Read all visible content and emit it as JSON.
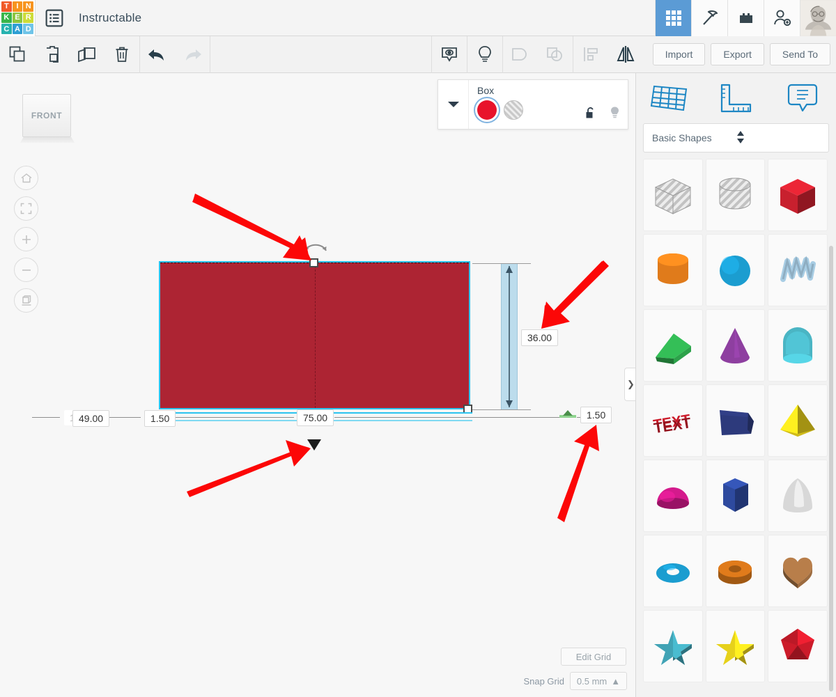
{
  "app": {
    "brand_letters": [
      "T",
      "I",
      "N",
      "K",
      "E",
      "R",
      "C",
      "A",
      "D"
    ],
    "brand_colors": [
      "#f15a29",
      "#f7941e",
      "#f7941e",
      "#39b54a",
      "#8dc63f",
      "#cddc39",
      "#27b3b0",
      "#2e9fd4",
      "#6fc4e8"
    ],
    "document_title": "Instructable"
  },
  "topbar": {
    "icons": [
      {
        "name": "hamburger-menu-icon",
        "label": "Menu"
      },
      {
        "name": "grid-apps-icon",
        "label": "Apps",
        "active": true
      },
      {
        "name": "pickaxe-minecraft-icon",
        "label": "Minecraft"
      },
      {
        "name": "lego-brick-icon",
        "label": "Blocks"
      },
      {
        "name": "add-person-icon",
        "label": "Invite"
      },
      {
        "name": "user-avatar",
        "label": "Account"
      }
    ]
  },
  "toolbar": {
    "left_tools": [
      {
        "name": "copy-icon",
        "label": "Copy"
      },
      {
        "name": "paste-icon",
        "label": "Paste"
      },
      {
        "name": "duplicate-icon",
        "label": "Duplicate"
      },
      {
        "name": "delete-trash-icon",
        "label": "Delete"
      }
    ],
    "history_tools": [
      {
        "name": "undo-icon",
        "label": "Undo",
        "enabled": true
      },
      {
        "name": "redo-icon",
        "label": "Redo",
        "enabled": false
      }
    ],
    "right_tools": [
      {
        "name": "visibility-eye-icon",
        "label": "Show all",
        "enabled": true
      },
      {
        "name": "lightbulb-icon",
        "label": "Hide",
        "enabled": true
      },
      {
        "name": "group-icon",
        "label": "Group",
        "enabled": false
      },
      {
        "name": "ungroup-icon",
        "label": "Ungroup",
        "enabled": false
      },
      {
        "name": "align-icon",
        "label": "Align",
        "enabled": true
      },
      {
        "name": "mirror-flip-icon",
        "label": "Mirror",
        "enabled": true
      }
    ],
    "import_label": "Import",
    "export_label": "Export",
    "sendto_label": "Send To"
  },
  "canvas": {
    "view_cube_label": "FRONT",
    "nav_buttons": [
      {
        "name": "home-view-icon",
        "label": "Home view"
      },
      {
        "name": "fit-to-view-icon",
        "label": "Fit all in view"
      },
      {
        "name": "zoom-in-icon",
        "label": "Zoom in"
      },
      {
        "name": "zoom-out-icon",
        "label": "Zoom out"
      },
      {
        "name": "orthographic-toggle-icon",
        "label": "Switch to orthographic/perspective"
      }
    ],
    "object_panel": {
      "title": "Box",
      "solid_color": "#e8132b",
      "solid_label": "Solid",
      "hole_label": "Hole",
      "lock_icon": "unlock-icon",
      "light_icon": "lightbulb-icon"
    },
    "dimensions": {
      "height_label": "36.00",
      "width_label": "75.00",
      "left_offset_label": "49.00",
      "left_small_label": "1.5",
      "left_inner_label": "1.50",
      "right_label": "1.50"
    },
    "side_tab_label": "❯",
    "edit_grid_label": "Edit Grid",
    "snap_grid_label": "Snap Grid",
    "snap_grid_value": "0.5 mm",
    "shape_fill": "#ad2433",
    "selection_outline": "#2bc4ef"
  },
  "right_panel": {
    "top_icons": [
      {
        "name": "workplane-icon",
        "label": "Workplane"
      },
      {
        "name": "ruler-icon",
        "label": "Ruler"
      },
      {
        "name": "notes-icon",
        "label": "Notes"
      }
    ],
    "category_label": "Basic Shapes",
    "shapes": [
      {
        "name": "shape-box-hole",
        "label": "Box (hole)",
        "kind": "box",
        "color": "#c9c9c9",
        "hole": true
      },
      {
        "name": "shape-cylinder-hole",
        "label": "Cylinder (hole)",
        "kind": "cylinder",
        "color": "#c9c9c9",
        "hole": true
      },
      {
        "name": "shape-box",
        "label": "Box",
        "kind": "box",
        "color": "#c8202e",
        "hole": false
      },
      {
        "name": "shape-cylinder",
        "label": "Cylinder",
        "kind": "cylinder",
        "color": "#e07b1b",
        "hole": false
      },
      {
        "name": "shape-sphere",
        "label": "Sphere",
        "kind": "sphere",
        "color": "#1b9dd0",
        "hole": false
      },
      {
        "name": "shape-scribble",
        "label": "Scribble",
        "kind": "scribble",
        "color": "#a8cde4",
        "hole": false
      },
      {
        "name": "shape-roof",
        "label": "Roof",
        "kind": "wedge",
        "color": "#2ca24a",
        "hole": false
      },
      {
        "name": "shape-cone",
        "label": "Cone",
        "kind": "cone",
        "color": "#8e3fa0",
        "hole": false
      },
      {
        "name": "shape-half-cylinder",
        "label": "Half cylinder",
        "kind": "halfcyl",
        "color": "#4ab5c4",
        "hole": false
      },
      {
        "name": "shape-text",
        "label": "Text",
        "kind": "text",
        "color": "#cc1b2a",
        "hole": false
      },
      {
        "name": "shape-wedge",
        "label": "Wedge",
        "kind": "wedgeblock",
        "color": "#2d3a7c",
        "hole": false
      },
      {
        "name": "shape-pyramid",
        "label": "Pyramid",
        "kind": "pyramid",
        "color": "#e2cb1b",
        "hole": false
      },
      {
        "name": "shape-half-sphere",
        "label": "Half sphere",
        "kind": "dome",
        "color": "#d41a8c",
        "hole": false
      },
      {
        "name": "shape-polygon",
        "label": "Polygon",
        "kind": "polygon",
        "color": "#2e4a9e",
        "hole": false
      },
      {
        "name": "shape-paraboloid",
        "label": "Paraboloid",
        "kind": "paraboloid",
        "color": "#d8d8d8",
        "hole": false
      },
      {
        "name": "shape-torus",
        "label": "Torus",
        "kind": "torus",
        "color": "#1b9dd0",
        "hole": false
      },
      {
        "name": "shape-tube",
        "label": "Tube",
        "kind": "tube",
        "color": "#e07b1b",
        "hole": false
      },
      {
        "name": "shape-heart",
        "label": "Heart",
        "kind": "heart",
        "color": "#9c6b3f",
        "hole": false
      },
      {
        "name": "shape-star-thin",
        "label": "Star",
        "kind": "star",
        "color": "#3f9fb0",
        "hole": false
      },
      {
        "name": "shape-star",
        "label": "Star extruded",
        "kind": "star",
        "color": "#e2cb1b",
        "hole": false
      },
      {
        "name": "shape-polyhedron",
        "label": "Polyhedra",
        "kind": "polyhedron",
        "color": "#cc1b2a",
        "hole": false
      }
    ]
  },
  "annotations": {
    "arrow_color": "#fc0707",
    "arrows": [
      {
        "name": "annotation-arrow-rotate-handle"
      },
      {
        "name": "annotation-arrow-height-dim"
      },
      {
        "name": "annotation-arrow-center-marker"
      },
      {
        "name": "annotation-arrow-right-dim"
      }
    ]
  }
}
